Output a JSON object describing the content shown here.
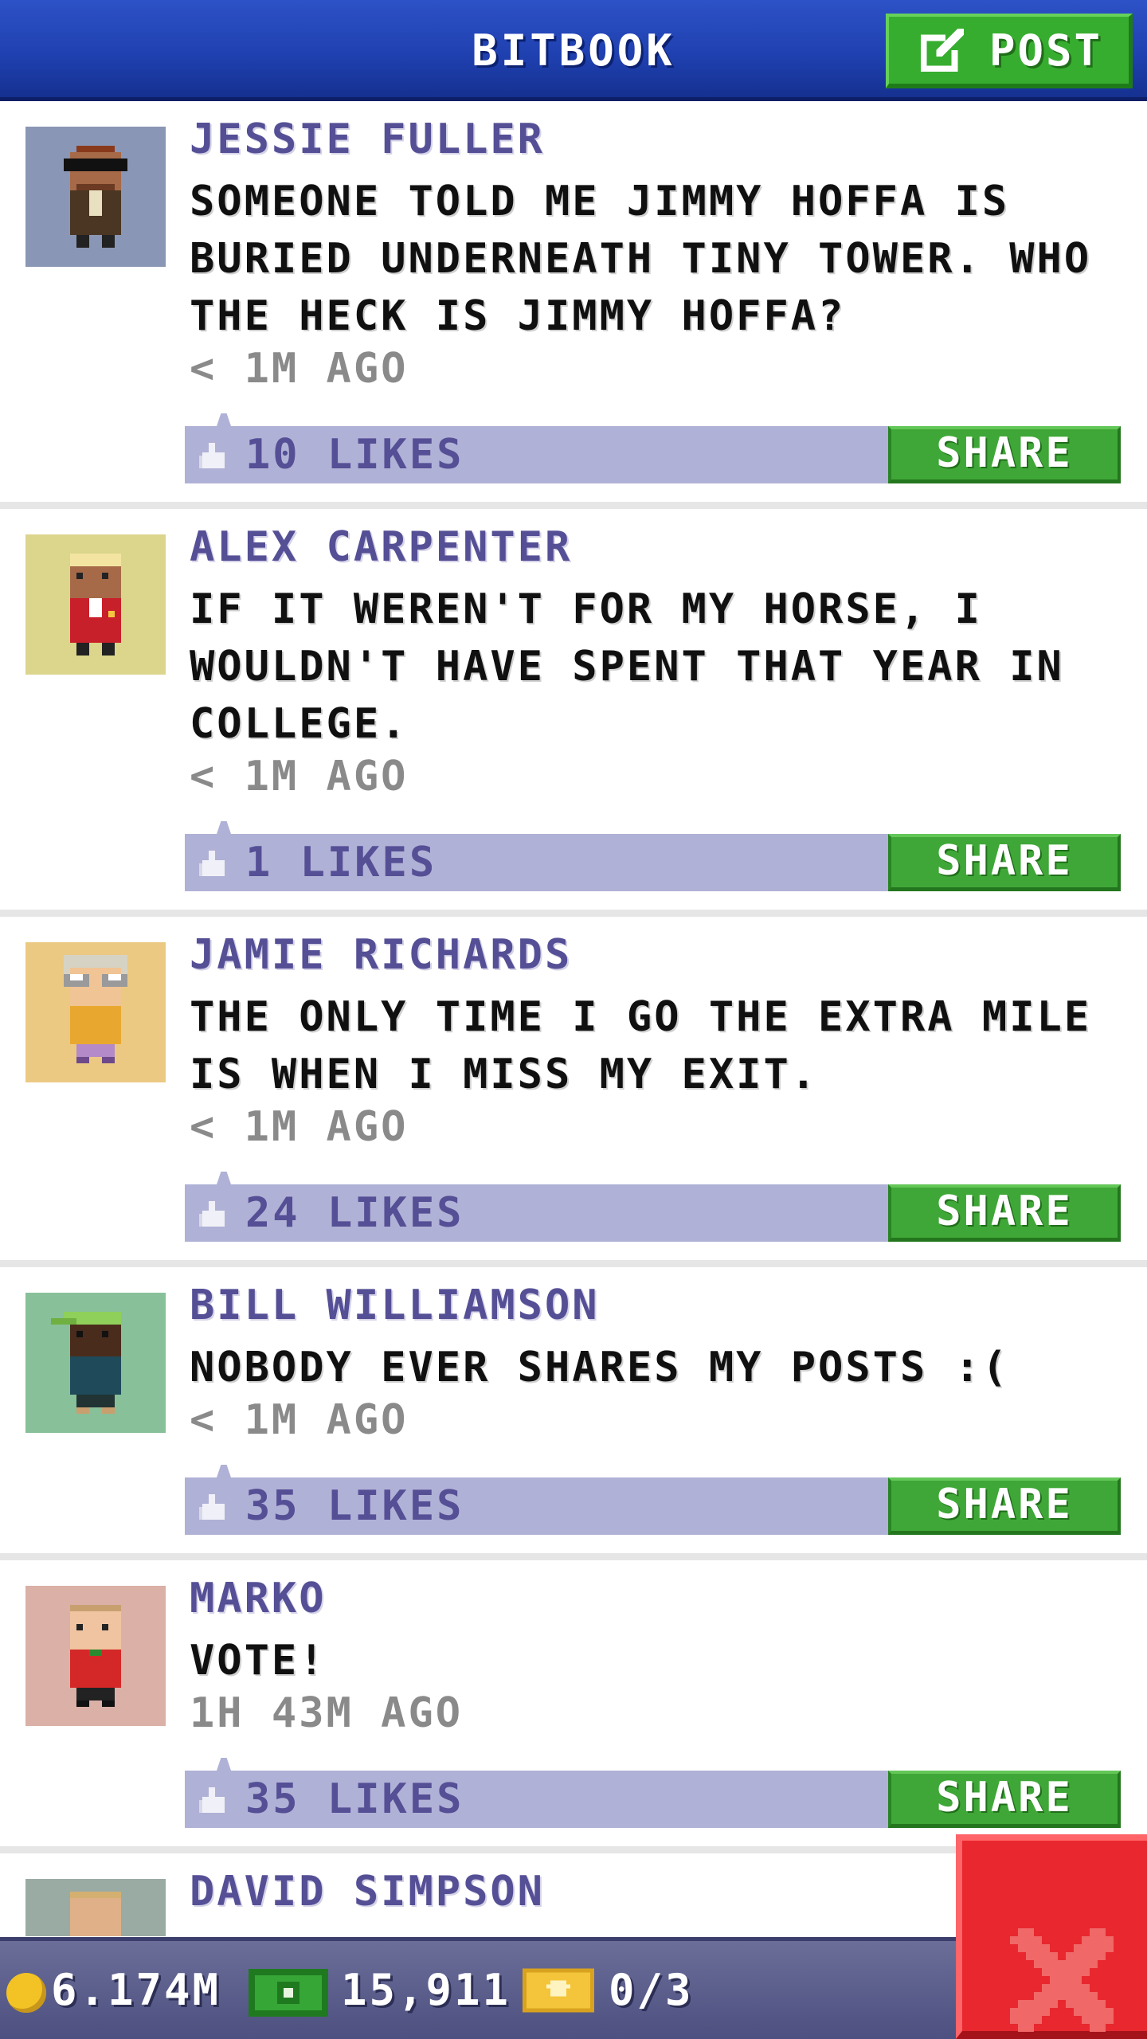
{
  "header": {
    "title": "BITBOOK",
    "post_label": "POST"
  },
  "posts": [
    {
      "author": "JESSIE FULLER",
      "message": "SOMEONE TOLD ME JIMMY HOFFA IS BURIED UNDERNEATH TINY TOWER. WHO THE HECK IS JIMMY HOFFA?",
      "time": "< 1M AGO",
      "likes": "10 LIKES",
      "share_label": "SHARE",
      "avatar": "man-with-sunglasses-avatar"
    },
    {
      "author": "ALEX CARPENTER",
      "message": "IF IT WEREN'T FOR MY HORSE, I WOULDN'T HAVE SPENT THAT YEAR IN COLLEGE.",
      "time": "< 1M AGO",
      "likes": "1 LIKES",
      "share_label": "SHARE",
      "avatar": "blond-man-red-vest-avatar"
    },
    {
      "author": "JAMIE RICHARDS",
      "message": "THE ONLY TIME I GO THE EXTRA MILE IS WHEN I MISS MY EXIT.",
      "time": "< 1M AGO",
      "likes": "24 LIKES",
      "share_label": "SHARE",
      "avatar": "old-person-glasses-avatar"
    },
    {
      "author": "BILL WILLIAMSON",
      "message": "NOBODY EVER SHARES MY POSTS :(",
      "time": "< 1M AGO",
      "likes": "35 LIKES",
      "share_label": "SHARE",
      "avatar": "man-green-cap-avatar"
    },
    {
      "author": "MARKO",
      "message": "VOTE!",
      "time": "1H 43M AGO",
      "likes": "35 LIKES",
      "share_label": "SHARE",
      "avatar": "man-red-shirt-avatar"
    },
    {
      "author": "DAVID SIMPSON",
      "avatar": "bald-man-avatar"
    }
  ],
  "status": {
    "coins": "6.174M",
    "cash": "15,911",
    "bux": "0/3"
  },
  "colors": {
    "header_blue": "#2047b8",
    "accent_green": "#3fa737",
    "like_bar": "#b0b1d6",
    "author_purple": "#554f96",
    "close_red": "#e8282e"
  },
  "icons": [
    "edit-icon",
    "thumbs-up-icon",
    "coin-icon",
    "cash-icon",
    "bux-icon",
    "close-icon"
  ]
}
